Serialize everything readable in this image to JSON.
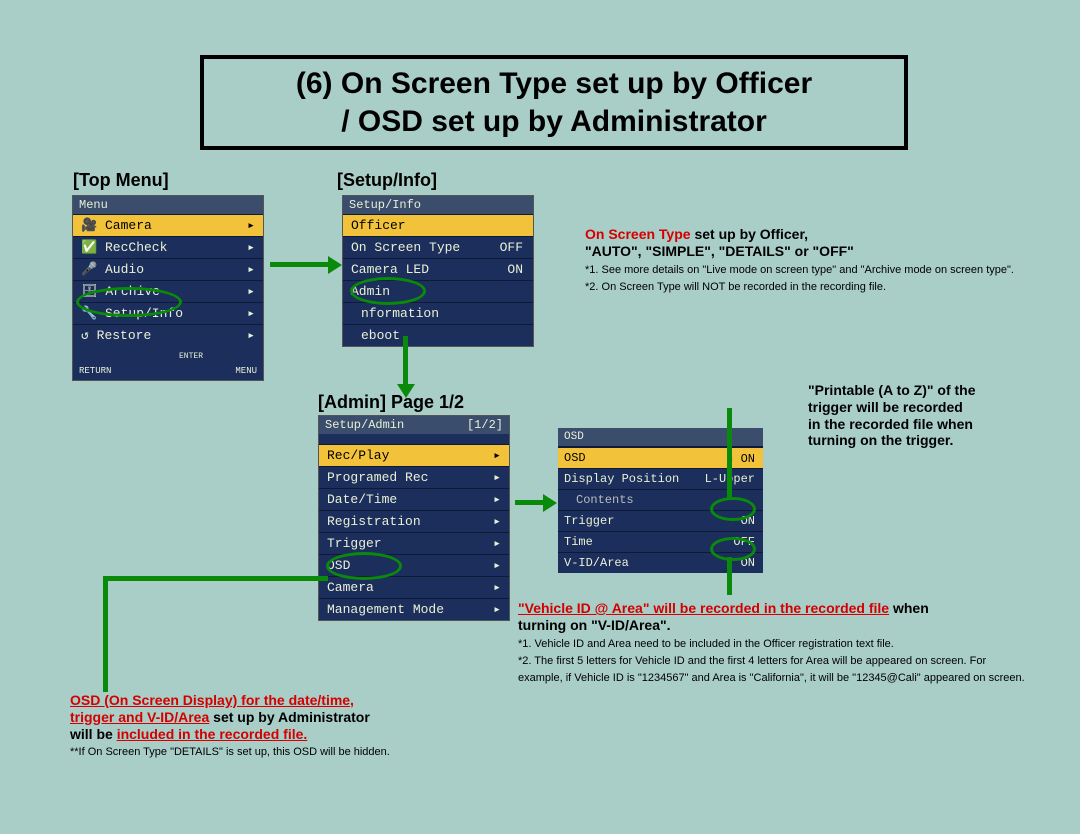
{
  "title_line1": "(6) On Screen Type set up by Officer",
  "title_line2": "/ OSD set up by Administrator",
  "labels": {
    "top_menu": "[Top Menu]",
    "setup_info": "[Setup/Info]",
    "admin_page": "[Admin] Page 1/2"
  },
  "top_menu": {
    "header": "Menu",
    "items": [
      "Camera",
      "RecCheck",
      "Audio",
      "Archive",
      "Setup/Info",
      "Restore"
    ],
    "footer_left": "RETURN",
    "footer_enter": "ENTER",
    "footer_right": "MENU"
  },
  "setup_info": {
    "header": "Setup/Info",
    "officer_hdr": "Officer",
    "rows": [
      {
        "label": "On Screen Type",
        "val": "OFF"
      },
      {
        "label": "Camera LED",
        "val": "ON"
      }
    ],
    "admin_hdr": "Admin",
    "sub_items": [
      "nformation",
      "eboot"
    ]
  },
  "admin_panel": {
    "header": "Setup/Admin",
    "pager": "[1/2]",
    "items": [
      "Rec/Play",
      "Programed Rec",
      "Date/Time",
      "Registration",
      "Trigger",
      "OSD",
      "Camera",
      "Management Mode"
    ]
  },
  "osd_panel": {
    "hdr": "OSD",
    "rows": [
      {
        "label": "OSD",
        "val": "ON",
        "hi": true
      },
      {
        "label": "Display Position",
        "val": "L-Upper"
      },
      {
        "label": "Contents",
        "val": "",
        "sub": true
      },
      {
        "label": "Trigger",
        "val": "ON"
      },
      {
        "label": "Time",
        "val": "OFF"
      },
      {
        "label": "V-ID/Area",
        "val": "ON"
      }
    ]
  },
  "notes": {
    "n1_red": "On Screen Type",
    "n1_rest": " set up by Officer,",
    "n1_line2": "\"AUTO\", \"SIMPLE\", \"DETAILS\" or \"OFF\"",
    "n1_fine1": "*1. See more details on \"Live mode on screen type\" and \"Archive mode on screen type\".",
    "n1_fine2": "*2. On Screen Type will NOT be recorded in the recording file.",
    "n2_l1": "\"Printable (A to Z)\" of the",
    "n2_l2": "trigger will be recorded",
    "n2_l3": "in the recorded file when",
    "n2_l4": "turning on the trigger.",
    "n3_red": "\"Vehicle ID @ Area\" will be recorded in the recorded file",
    "n3_rest": " when",
    "n3_l2": "turning on \"V-ID/Area\".",
    "n3_fine1": "*1.  Vehicle ID and Area need to be included in the Officer registration text file.",
    "n3_fine2": "*2.  The first 5 letters for Vehicle ID and the first 4 letters for Area will be appeared on screen.  For example, if Vehicle ID is \"1234567\" and Area is \"California\", it will be \"12345@Cali\" appeared on screen.",
    "n4_l1": "OSD (On Screen Display) for the date/time,",
    "n4_l2": "trigger and V-ID/Area",
    "n4_l2_rest": " set up by Administrator",
    "n4_l3a": "will be ",
    "n4_l3b": "included in the recorded file.",
    "n4_fine": "**If On Screen Type \"DETAILS\" is set up, this OSD will be hidden."
  }
}
